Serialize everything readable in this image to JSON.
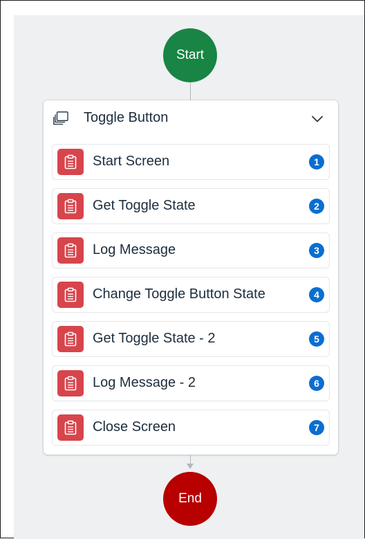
{
  "flow": {
    "start_label": "Start",
    "end_label": "End",
    "group": {
      "title": "Toggle Button",
      "icon": "copy-icon",
      "expand_icon": "chevron-down-icon",
      "steps": [
        {
          "label": "Start Screen",
          "index": "1",
          "icon": "clipboard-icon"
        },
        {
          "label": "Get Toggle State",
          "index": "2",
          "icon": "clipboard-icon"
        },
        {
          "label": "Log Message",
          "index": "3",
          "icon": "clipboard-icon"
        },
        {
          "label": "Change Toggle Button State",
          "index": "4",
          "icon": "clipboard-icon"
        },
        {
          "label": "Get Toggle State - 2",
          "index": "5",
          "icon": "clipboard-icon"
        },
        {
          "label": "Log Message - 2",
          "index": "6",
          "icon": "clipboard-icon"
        },
        {
          "label": "Close Screen",
          "index": "7",
          "icon": "clipboard-icon"
        }
      ]
    }
  },
  "colors": {
    "start_node": "#188544",
    "end_node": "#b80000",
    "step_icon_bg": "#d7454c",
    "badge": "#0a6ed1",
    "canvas": "#eff0f2"
  }
}
